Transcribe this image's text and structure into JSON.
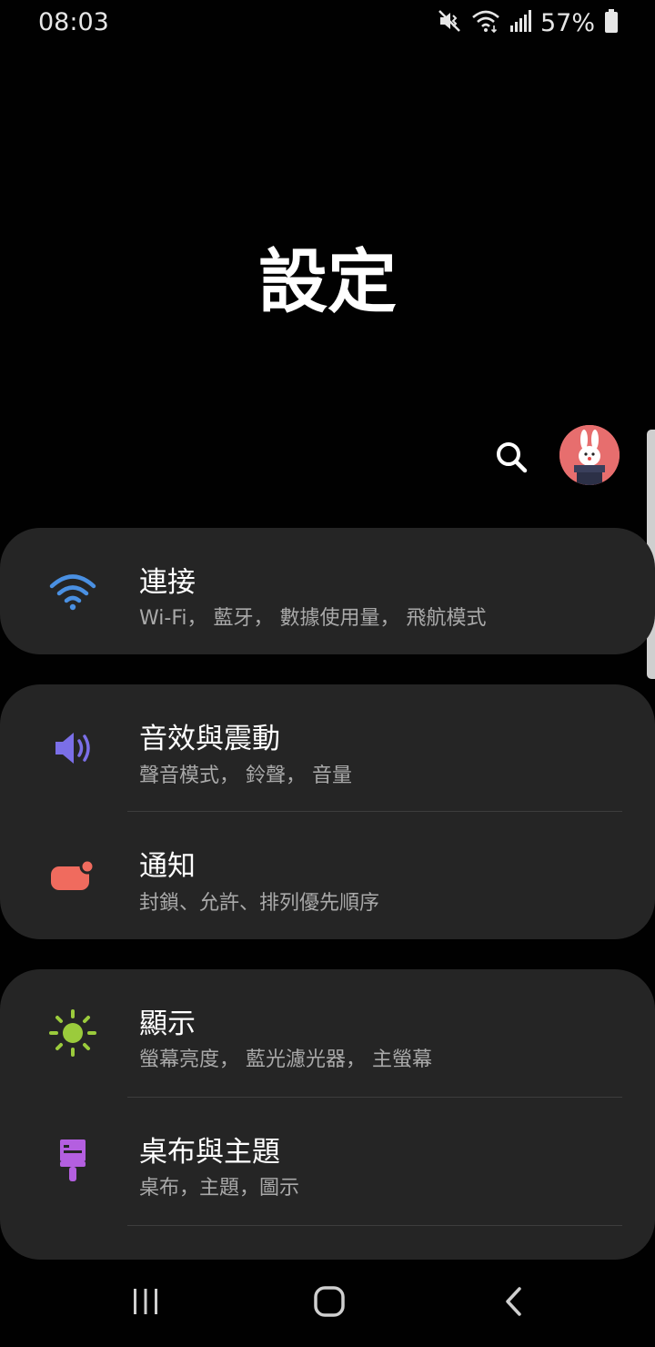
{
  "status_bar": {
    "time": "08:03",
    "battery_percent": "57%",
    "icons": [
      "mute-icon",
      "wifi-icon",
      "signal-icon",
      "battery-icon"
    ]
  },
  "page": {
    "title": "設定"
  },
  "toolbar": {
    "search_icon": "search-icon",
    "avatar": "profile-avatar"
  },
  "sections": [
    {
      "items": [
        {
          "title": "連接",
          "subtitle": "Wi-Fi， 藍牙， 數據使用量， 飛航模式",
          "icon": "wifi-icon",
          "icon_color": "#4a90e2"
        }
      ]
    },
    {
      "items": [
        {
          "title": "音效與震動",
          "subtitle": "聲音模式， 鈴聲， 音量",
          "icon": "speaker-icon",
          "icon_color": "#7b6fe8"
        },
        {
          "title": "通知",
          "subtitle": "封鎖、允許、排列優先順序",
          "icon": "notification-icon",
          "icon_color": "#f06b5e"
        }
      ]
    },
    {
      "items": [
        {
          "title": "顯示",
          "subtitle": "螢幕亮度， 藍光濾光器， 主螢幕",
          "icon": "brightness-icon",
          "icon_color": "#9bcb3c"
        },
        {
          "title": "桌布與主題",
          "subtitle": "桌布，主題，圖示",
          "icon": "paintbrush-icon",
          "icon_color": "#b45fe0"
        }
      ]
    }
  ],
  "nav_bar": {
    "buttons": [
      "recents-icon",
      "home-icon",
      "back-icon"
    ]
  },
  "colors": {
    "background": "#010101",
    "card": "#252525",
    "subtitle": "#a9a9a9"
  }
}
